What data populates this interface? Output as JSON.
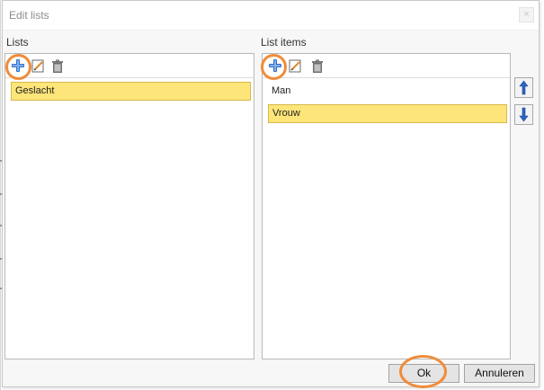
{
  "dialog": {
    "title": "Edit lists",
    "close_label": "×"
  },
  "lists": {
    "label": "Lists",
    "items": [
      {
        "label": "Geslacht",
        "selected": true
      }
    ]
  },
  "list_items": {
    "label": "List items",
    "items": [
      {
        "label": "Man",
        "selected": false
      },
      {
        "label": "Vrouw",
        "selected": true
      }
    ]
  },
  "footer": {
    "ok_label": "Ok",
    "cancel_label": "Annuleren"
  },
  "colors": {
    "highlight_ring": "#f08c3a",
    "selection": "#fde57a",
    "add_icon": "#2f6fc8",
    "arrow_icon": "#2c63c4"
  },
  "icons": {
    "add": "plus-icon",
    "edit": "edit-icon",
    "delete": "trash-icon",
    "move_up": "arrow-up-icon",
    "move_down": "arrow-down-icon"
  }
}
